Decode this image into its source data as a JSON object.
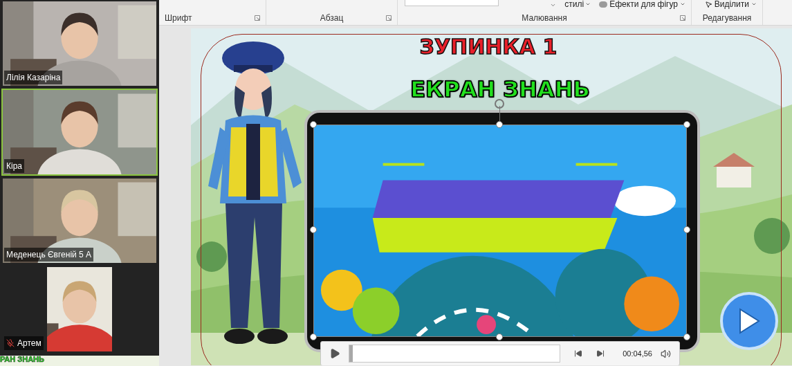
{
  "participants": [
    {
      "name": "Лілія Казаріна",
      "speaking": false,
      "muted": false,
      "kind": "landscape"
    },
    {
      "name": "Кіра",
      "speaking": true,
      "muted": false,
      "kind": "landscape"
    },
    {
      "name": "Меденець Євгеній 5 А",
      "speaking": false,
      "muted": false,
      "kind": "landscape"
    },
    {
      "name": "Артем",
      "speaking": false,
      "muted": true,
      "kind": "portrait"
    }
  ],
  "thumbnail": {
    "text": "РАН ЗНАНЬ"
  },
  "ribbon": {
    "groups": [
      {
        "label": "Шрифт",
        "launcher": true
      },
      {
        "label": "Абзац",
        "launcher": true
      },
      {
        "label": "Малювання",
        "launcher": true,
        "items": [
          {
            "kind": "dropdown",
            "label": "стилі"
          },
          {
            "kind": "effects",
            "label": "Ефекти для фігур"
          }
        ]
      },
      {
        "label": "Редагування",
        "launcher": false,
        "items": [
          {
            "kind": "select",
            "label": "Виділити"
          }
        ]
      }
    ]
  },
  "slide": {
    "title": "ЗУПИНКА 1",
    "subtitle": "ЕКРАН ЗНАНЬ",
    "video": {
      "time": "00:04,56",
      "level": 0
    }
  }
}
